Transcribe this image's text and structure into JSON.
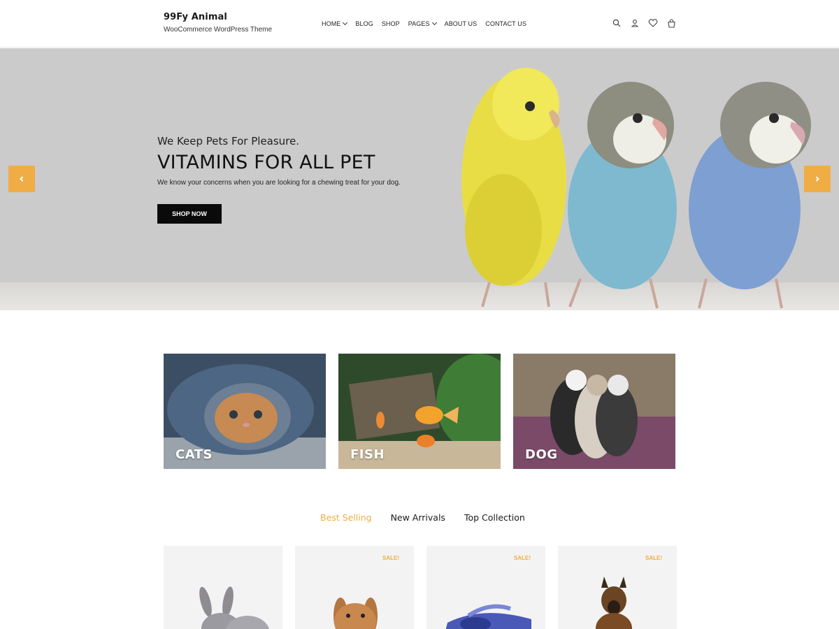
{
  "header": {
    "brand_title": "99Fy Animal",
    "brand_tagline": "WooCommerce WordPress Theme",
    "nav": [
      {
        "label": "HOME",
        "dropdown": true
      },
      {
        "label": "BLOG",
        "dropdown": false
      },
      {
        "label": "SHOP",
        "dropdown": false
      },
      {
        "label": "PAGES",
        "dropdown": true
      },
      {
        "label": "ABOUT US",
        "dropdown": false
      },
      {
        "label": "CONTACT US",
        "dropdown": false
      }
    ],
    "icons": [
      "search-icon",
      "user-icon",
      "heart-icon",
      "cart-icon"
    ]
  },
  "hero": {
    "subtitle": "We Keep Pets For Pleasure.",
    "title": "VITAMINS FOR ALL PET",
    "description": "We know your concerns when you are looking for a chewing treat for your dog.",
    "button": "SHOP NOW",
    "accent_color": "#f0ad45"
  },
  "categories": [
    {
      "label": "CATS"
    },
    {
      "label": "FISH"
    },
    {
      "label": "DOG"
    }
  ],
  "tabs": [
    {
      "label": "Best Selling",
      "active": true
    },
    {
      "label": "New Arrivals",
      "active": false
    },
    {
      "label": "Top Collection",
      "active": false
    }
  ],
  "products": [
    {
      "sale": ""
    },
    {
      "sale": "SALE!"
    },
    {
      "sale": "SALE!"
    },
    {
      "sale": "SALE!"
    }
  ]
}
